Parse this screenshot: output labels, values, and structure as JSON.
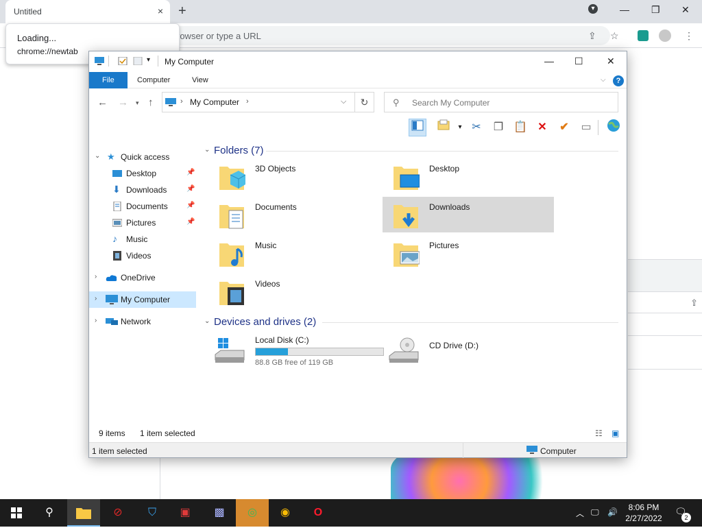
{
  "browser": {
    "tab_title": "Untitled",
    "tab_close": "×",
    "new_tab": "+",
    "omnibox_placeholder": "rowser or type a URL",
    "loading_title": "Loading...",
    "loading_url": "chrome://newtab",
    "controls": {
      "profile": "▾",
      "minimize": "—",
      "maximize": "❐",
      "close": "✕"
    }
  },
  "explorer": {
    "title": "My Computer",
    "window_controls": {
      "minimize": "—",
      "maximize": "☐",
      "close": "✕"
    },
    "ribbon": {
      "file": "File",
      "tabs": [
        "Computer",
        "View"
      ],
      "help": "?"
    },
    "address": {
      "location": "My Computer"
    },
    "search": {
      "placeholder": "Search My Computer"
    },
    "nav": {
      "quick_access": "Quick access",
      "quick_items": [
        "Desktop",
        "Downloads",
        "Documents",
        "Pictures",
        "Music",
        "Videos"
      ],
      "onedrive": "OneDrive",
      "my_computer": "My Computer",
      "network": "Network"
    },
    "folders_header": "Folders (7)",
    "folders": [
      {
        "name": "3D Objects"
      },
      {
        "name": "Desktop"
      },
      {
        "name": "Documents"
      },
      {
        "name": "Downloads"
      },
      {
        "name": "Music"
      },
      {
        "name": "Pictures"
      },
      {
        "name": "Videos"
      }
    ],
    "selected_folder": "Downloads",
    "drives_header": "Devices and drives (2)",
    "drives": [
      {
        "name": "Local Disk (C:)",
        "free": "88.8 GB free of 119 GB",
        "used_fraction": 0.254
      },
      {
        "name": "CD Drive (D:)"
      }
    ],
    "count": {
      "items": "9 items",
      "selected": "1 item selected"
    },
    "status": {
      "left": "1 item selected",
      "right": "Computer"
    }
  },
  "taskbar": {
    "time": "8:06 PM",
    "date": "2/27/2022",
    "notifications": "2"
  },
  "colors": {
    "accent": "#1979ca",
    "selection": "#cce8ff",
    "folder_yellow": "#f8d775",
    "taskbar": "#1c1c1c"
  }
}
